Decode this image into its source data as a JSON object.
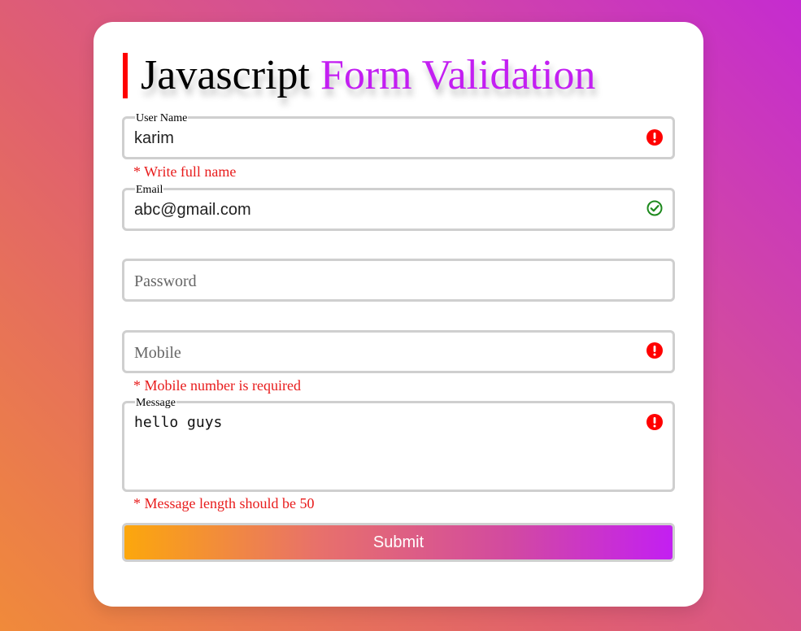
{
  "title": {
    "part1": "Javascript",
    "part2": "Form Validation"
  },
  "fields": {
    "username": {
      "label": "User Name",
      "value": "karim",
      "status": "error",
      "error": "* Write full name"
    },
    "email": {
      "label": "Email",
      "value": "abc@gmail.com",
      "status": "success"
    },
    "password": {
      "placeholder": "Password"
    },
    "mobile": {
      "placeholder": "Mobile",
      "status": "error",
      "error": "* Mobile number is required"
    },
    "message": {
      "label": "Message",
      "value": "hello guys",
      "status": "error",
      "error": "* Message length should be 50"
    }
  },
  "submit": {
    "label": "Submit"
  },
  "colors": {
    "accent": "#c31ff2",
    "error": "#e81c1c",
    "success": "#1e8a1e",
    "title_bar": "#ff0000"
  },
  "icons": {
    "error": "exclamation-circle-icon",
    "success": "check-circle-icon"
  }
}
